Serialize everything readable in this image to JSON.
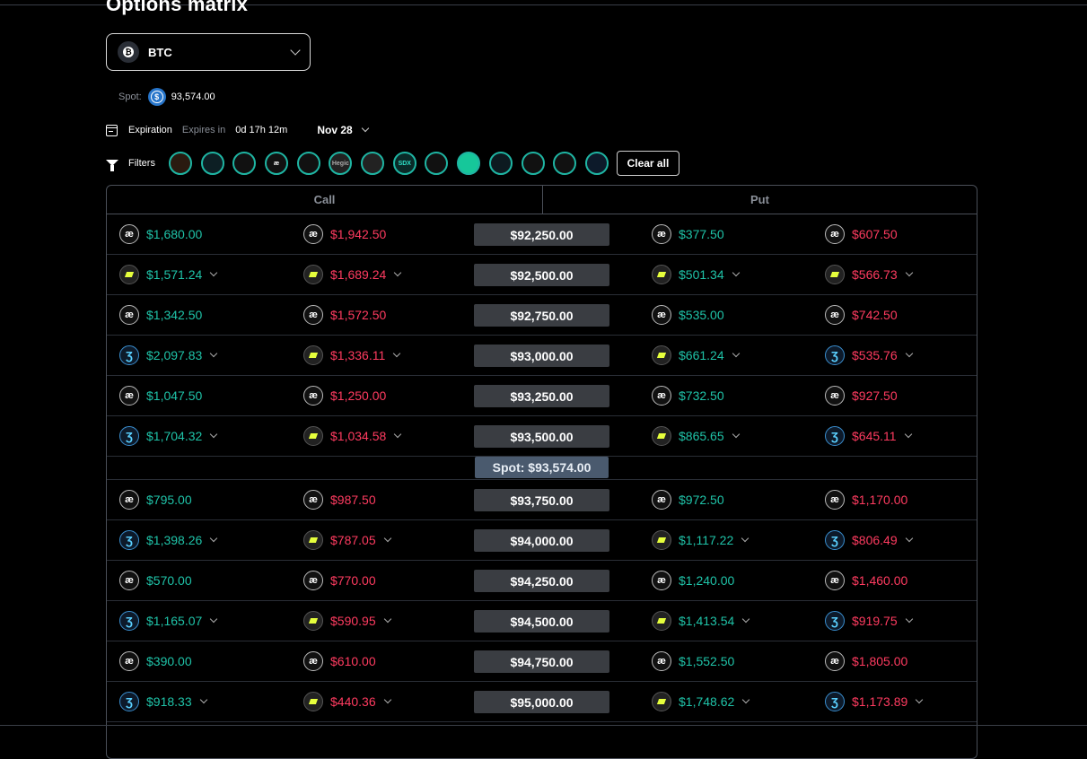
{
  "page_title": "Options matrix",
  "asset": {
    "symbol": "BTC",
    "icon": "bitcoin-icon"
  },
  "spot": {
    "label": "Spot:",
    "value": "93,574.00",
    "icon": "usdc-icon"
  },
  "expiration": {
    "label": "Expiration",
    "expires_in_label": "Expires in",
    "time_left": "0d 17h 12m",
    "date": "Nov 28"
  },
  "filters": {
    "label": "Filters",
    "protocols": [
      "",
      "",
      "",
      "æ",
      "",
      "Hegic",
      "",
      "SDX",
      "",
      "",
      "",
      "",
      "",
      ""
    ],
    "clear_label": "Clear all",
    "accent": "#1fb5a3"
  },
  "matrix": {
    "call_header": "Call",
    "put_header": "Put",
    "spot_chip": "Spot: $93,574.00",
    "colors": {
      "buy": "#1fc3a8",
      "sell": "#ff3b60"
    },
    "rows_above": [
      {
        "strike": "$92,250.00",
        "c1": "$1,680.00",
        "c1i": "ae",
        "c2": "$1,942.50",
        "c2i": "ae",
        "p1": "$377.50",
        "p1i": "ae",
        "p2": "$607.50",
        "p2i": "ae",
        "dd": false
      },
      {
        "strike": "$92,500.00",
        "c1": "$1,571.24",
        "c1i": "der",
        "c2": "$1,689.24",
        "c2i": "der",
        "p1": "$501.34",
        "p1i": "der",
        "p2": "$566.73",
        "p2i": "der",
        "dd": true
      },
      {
        "strike": "$92,750.00",
        "c1": "$1,342.50",
        "c1i": "ae",
        "c2": "$1,572.50",
        "c2i": "ae",
        "p1": "$535.00",
        "p1i": "ae",
        "p2": "$742.50",
        "p2i": "ae",
        "dd": false
      },
      {
        "strike": "$93,000.00",
        "c1": "$2,097.83",
        "c1i": "thal",
        "c2": "$1,336.11",
        "c2i": "der",
        "p1": "$661.24",
        "p1i": "der",
        "p2": "$535.76",
        "p2i": "thal",
        "dd": true
      },
      {
        "strike": "$93,250.00",
        "c1": "$1,047.50",
        "c1i": "ae",
        "c2": "$1,250.00",
        "c2i": "ae",
        "p1": "$732.50",
        "p1i": "ae",
        "p2": "$927.50",
        "p2i": "ae",
        "dd": false
      },
      {
        "strike": "$93,500.00",
        "c1": "$1,704.32",
        "c1i": "thal",
        "c2": "$1,034.58",
        "c2i": "der",
        "p1": "$865.65",
        "p1i": "der",
        "p2": "$645.11",
        "p2i": "thal",
        "dd": true
      }
    ],
    "rows_below": [
      {
        "strike": "$93,750.00",
        "c1": "$795.00",
        "c1i": "ae",
        "c2": "$987.50",
        "c2i": "ae",
        "p1": "$972.50",
        "p1i": "ae",
        "p2": "$1,170.00",
        "p2i": "ae",
        "dd": false
      },
      {
        "strike": "$94,000.00",
        "c1": "$1,398.26",
        "c1i": "thal",
        "c2": "$787.05",
        "c2i": "der",
        "p1": "$1,117.22",
        "p1i": "der",
        "p2": "$806.49",
        "p2i": "thal",
        "dd": true
      },
      {
        "strike": "$94,250.00",
        "c1": "$570.00",
        "c1i": "ae",
        "c2": "$770.00",
        "c2i": "ae",
        "p1": "$1,240.00",
        "p1i": "ae",
        "p2": "$1,460.00",
        "p2i": "ae",
        "dd": false
      },
      {
        "strike": "$94,500.00",
        "c1": "$1,165.07",
        "c1i": "thal",
        "c2": "$590.95",
        "c2i": "der",
        "p1": "$1,413.54",
        "p1i": "der",
        "p2": "$919.75",
        "p2i": "thal",
        "dd": true
      },
      {
        "strike": "$94,750.00",
        "c1": "$390.00",
        "c1i": "ae",
        "c2": "$610.00",
        "c2i": "ae",
        "p1": "$1,552.50",
        "p1i": "ae",
        "p2": "$1,805.00",
        "p2i": "ae",
        "dd": false
      },
      {
        "strike": "$95,000.00",
        "c1": "$918.33",
        "c1i": "thal",
        "c2": "$440.36",
        "c2i": "der",
        "p1": "$1,748.62",
        "p1i": "der",
        "p2": "$1,173.89",
        "p2i": "thal",
        "dd": true
      }
    ]
  }
}
